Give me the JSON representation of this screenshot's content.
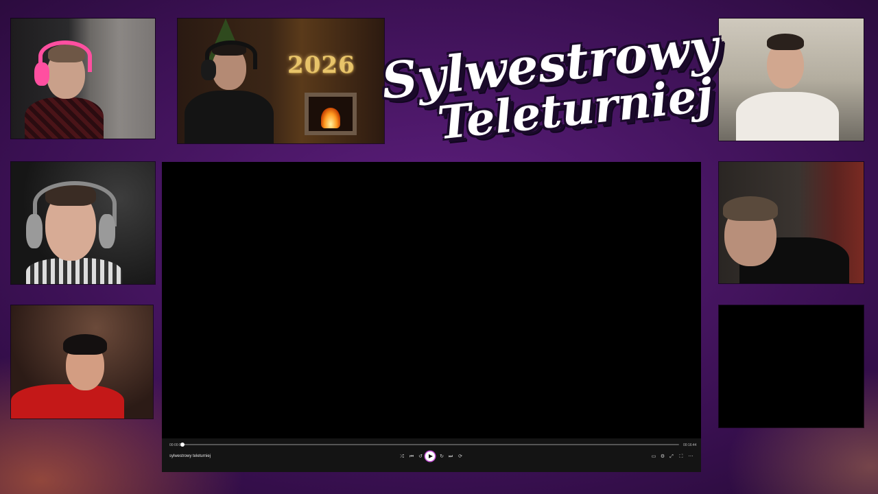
{
  "logo": {
    "line1": "Sylwestrowy",
    "line2": "Teleturniej"
  },
  "decor": {
    "ny_text": "2026"
  },
  "player": {
    "title": "sylwestrowy teleturniej",
    "time_current": "00:00:00",
    "time_total": "00:16:44",
    "progress": 0.0,
    "accent_color": "#c44fd6"
  },
  "icons": {
    "controls": [
      "shuffle-icon",
      "previous-icon",
      "rewind-icon",
      "play-icon",
      "forward-icon",
      "next-icon",
      "repeat-icon"
    ],
    "right_controls": [
      "miniplayer-icon",
      "settings-icon",
      "cast-icon",
      "fullscreen-icon",
      "more-icon"
    ]
  }
}
